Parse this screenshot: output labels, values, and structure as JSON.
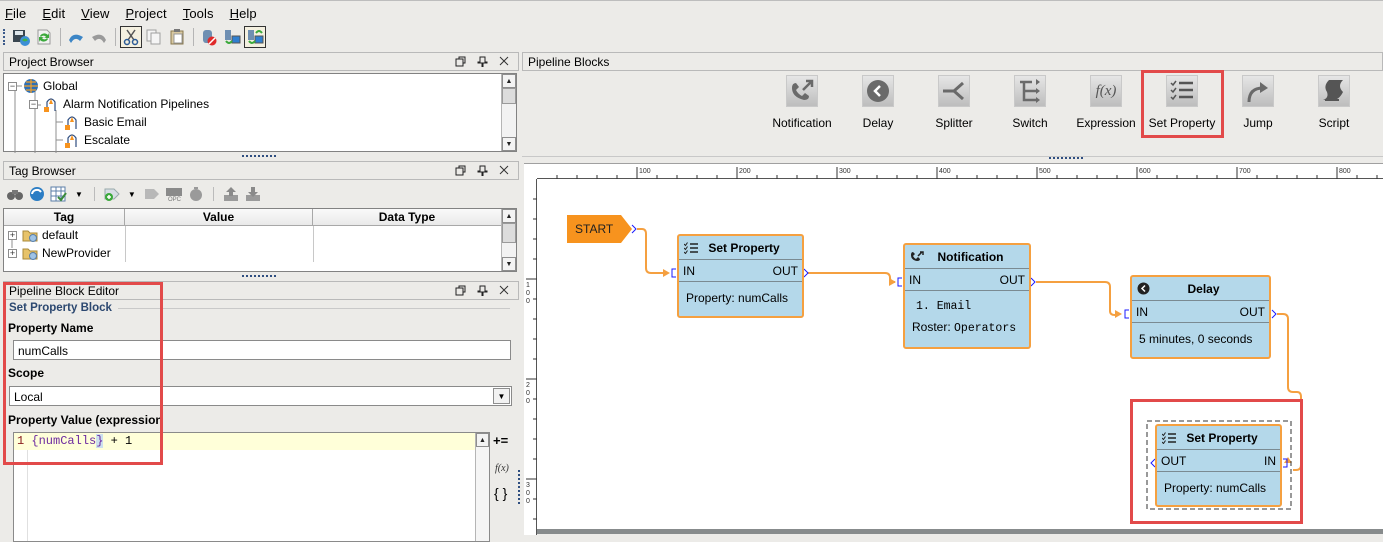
{
  "menubar": {
    "items": [
      "File",
      "Edit",
      "View",
      "Project",
      "Tools",
      "Help"
    ]
  },
  "toolbar": {
    "buttons": [
      {
        "icon": "save-publish-icon"
      },
      {
        "icon": "update-project-icon"
      },
      {
        "icon": "undo-icon"
      },
      {
        "icon": "redo-icon"
      },
      {
        "icon": "cut-icon",
        "pressed": true
      },
      {
        "icon": "copy-icon"
      },
      {
        "icon": "paste-icon"
      },
      {
        "icon": "disconnect-database-icon"
      },
      {
        "icon": "comm-read-only-icon"
      },
      {
        "icon": "comm-read-write-icon",
        "pressed": true
      }
    ]
  },
  "project_browser": {
    "title": "Project Browser",
    "tree": [
      {
        "label": "Global",
        "level": 0,
        "expander": "-",
        "icon": "globe-icon"
      },
      {
        "label": "Alarm Notification Pipelines",
        "level": 1,
        "expander": "-",
        "icon": "alarm-pipeline-folder-icon"
      },
      {
        "label": "Basic Email",
        "level": 2,
        "icon": "alarm-pipeline-icon"
      },
      {
        "label": "Escalate",
        "level": 2,
        "icon": "alarm-pipeline-icon"
      }
    ]
  },
  "tag_browser": {
    "title": "Tag Browser",
    "columns": [
      "Tag",
      "Value",
      "Data Type"
    ],
    "rows": [
      {
        "tag": "default",
        "value": "",
        "data_type": ""
      },
      {
        "tag": "NewProvider",
        "value": "",
        "data_type": ""
      }
    ],
    "toolbar_icons": [
      "binoculars-icon",
      "refresh-tags-icon",
      "table-check-icon",
      "dropdown-arrow-icon",
      "add-tag-icon",
      "dropdown-arrow-icon",
      "tag-edit-icon",
      "opc-icon",
      "stopwatch-icon",
      "export-icon",
      "import-icon"
    ]
  },
  "block_editor": {
    "title": "Pipeline Block Editor",
    "section_title": "Set Property Block",
    "property_name_label": "Property Name",
    "property_name_value": "numCalls",
    "scope_label": "Scope",
    "scope_value": "Local",
    "property_value_label": "Property Value (expression",
    "expression": {
      "line_number": "1",
      "open_brace": "{",
      "reference": "numCalls",
      "close_brace": "}",
      "rest": " + 1"
    },
    "side_buttons": [
      "+=",
      "f(x)",
      "{ }"
    ]
  },
  "pipeline_blocks": {
    "title": "Pipeline Blocks",
    "items": [
      {
        "label": "Notification",
        "icon": "notification-icon"
      },
      {
        "label": "Delay",
        "icon": "delay-clock-icon"
      },
      {
        "label": "Splitter",
        "icon": "splitter-icon"
      },
      {
        "label": "Switch",
        "icon": "switch-icon"
      },
      {
        "label": "Expression",
        "icon": "expression-fx-icon",
        "glyph": "f(x)"
      },
      {
        "label": "Set Property",
        "icon": "set-property-icon",
        "highlighted": true
      },
      {
        "label": "Jump",
        "icon": "jump-arrow-icon"
      },
      {
        "label": "Script",
        "icon": "script-scroll-icon"
      }
    ]
  },
  "canvas": {
    "ruler_top_labels": [
      "100",
      "200",
      "300",
      "400",
      "500",
      "600",
      "700",
      "800"
    ],
    "ruler_left_labels": [
      "100",
      "200",
      "300"
    ],
    "start_label": "START",
    "blocks": [
      {
        "id": "set-property-1",
        "title": "Set Property",
        "in": "IN",
        "out": "OUT",
        "body": [
          "Property: numCalls"
        ]
      },
      {
        "id": "notification",
        "title": "Notification",
        "in": "IN",
        "out": "OUT",
        "body": [
          "1. Email",
          "Roster: Operators"
        ],
        "body_parts": {
          "item": "1. Email",
          "roster_label": "Roster: ",
          "roster_value": "Operators"
        }
      },
      {
        "id": "delay",
        "title": "Delay",
        "in": "IN",
        "out": "OUT",
        "body": [
          "5 minutes, 0 seconds"
        ]
      },
      {
        "id": "set-property-2",
        "title": "Set Property",
        "in": "IN",
        "out": "OUT",
        "body": [
          "Property: numCalls"
        ],
        "selected": true
      }
    ]
  },
  "colors": {
    "block_fill": "#b4d8ea",
    "block_border": "#f5a040",
    "start_fill": "#f7931e",
    "connector": "#f5a040",
    "highlight_red": "#e24a4a",
    "port_blue": "#1a1aff"
  }
}
